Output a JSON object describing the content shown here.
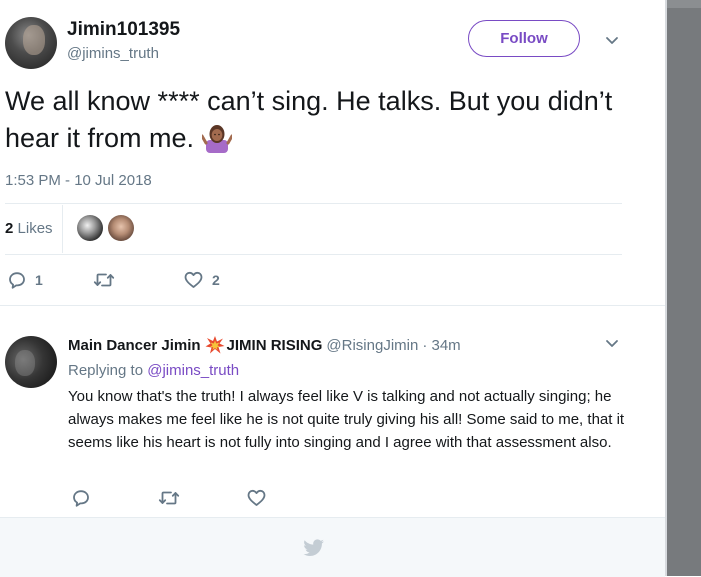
{
  "tweet": {
    "author": {
      "display_name": "Jimin101395",
      "handle": "@jimins_truth",
      "avatar_icon": "user-avatar"
    },
    "follow_label": "Follow",
    "text": "We all know **** can’t sing. He talks. But you didn’t hear it from me.",
    "emoji": "woman-shrugging-emoji",
    "timestamp": "1:53 PM - 10 Jul 2018",
    "likes_count": "2",
    "likes_label": "Likes",
    "actions": {
      "reply_count": "1",
      "retweet_count": "",
      "like_count": "2"
    }
  },
  "reply": {
    "author": {
      "display_name": "Main Dancer Jimin",
      "display_name_suffix": "JIMIN RISING",
      "handle": "@RisingJimin",
      "time": "· 34m",
      "emoji": "collision-emoji"
    },
    "replying_to_label": "Replying to",
    "replying_to_handle": "@jimins_truth",
    "text": "You know that's the truth! I always feel like V is talking and not actually singing; he always makes me feel like he is not quite truly giving his all! Some said to me, that it seems like his heart is not  fully into singing and I agree with that assessment also."
  },
  "colors": {
    "accent_purple": "#794bc4",
    "secondary_text": "#657786",
    "primary_text": "#14171a",
    "divider": "#e6ecf0",
    "footer_bg": "#f5f8fa",
    "scroll_strip": "#777a7d"
  },
  "footer": {
    "icon": "twitter-bird-icon"
  }
}
